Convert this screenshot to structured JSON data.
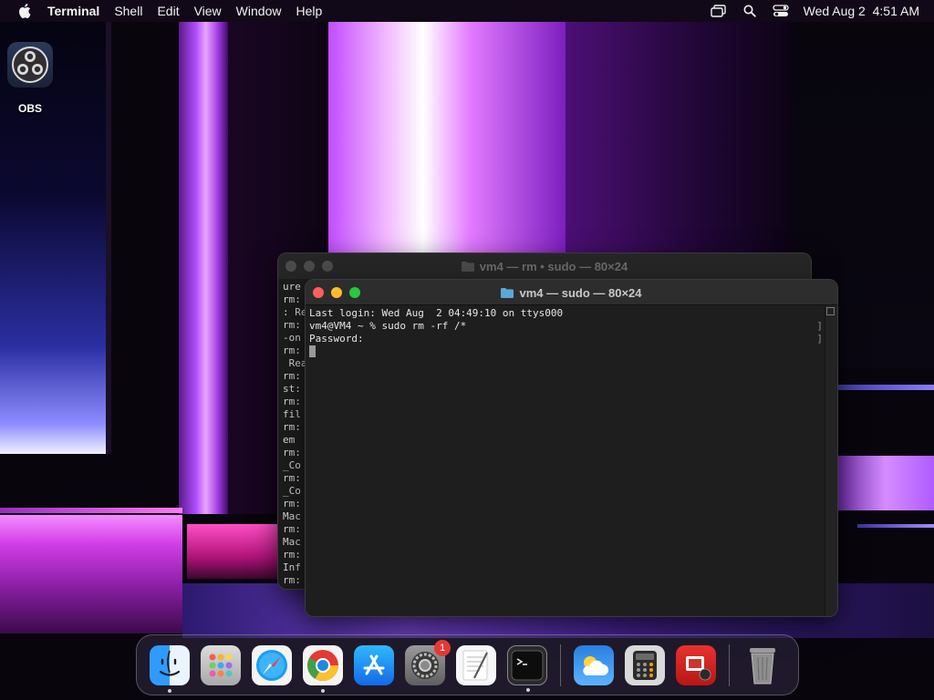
{
  "menubar": {
    "app_name": "Terminal",
    "items": [
      "Shell",
      "Edit",
      "View",
      "Window",
      "Help"
    ],
    "clock": "Wed Aug 2  4:51 AM"
  },
  "desktop": {
    "icons": [
      {
        "label": "OBS"
      }
    ]
  },
  "terminal_back": {
    "title": "vm4 — rm • sudo — 80×24",
    "lines": [
      "ure",
      "rm:",
      ": Re",
      "rm:",
      "-on",
      "rm:",
      " Rea",
      "rm:",
      "st:",
      "rm:",
      "fil",
      "rm:",
      "em",
      "rm:",
      "_Co",
      "rm:",
      "_Co",
      "rm:",
      "Mac",
      "rm:",
      "Mac",
      "rm:",
      "Inf",
      "rm:"
    ]
  },
  "terminal_front": {
    "title": "vm4 — sudo — 80×24",
    "lines": [
      "Last login: Wed Aug  2 04:49:10 on ttys000",
      "vm4@VM4 ~ % sudo rm -rf /*",
      "Password:"
    ]
  },
  "dock": {
    "apps": [
      {
        "name": "Finder",
        "running": true
      },
      {
        "name": "Launchpad",
        "running": false
      },
      {
        "name": "Safari",
        "running": false
      },
      {
        "name": "Google Chrome",
        "running": true
      },
      {
        "name": "App Store",
        "running": false
      },
      {
        "name": "System Settings",
        "running": false,
        "badge": "1"
      },
      {
        "name": "TextEdit",
        "running": false
      },
      {
        "name": "Terminal",
        "running": true
      },
      {
        "name": "Weather",
        "running": false
      },
      {
        "name": "Calculator",
        "running": false
      },
      {
        "name": "Photo Booth",
        "running": false
      },
      {
        "name": "Trash",
        "running": false
      }
    ]
  }
}
